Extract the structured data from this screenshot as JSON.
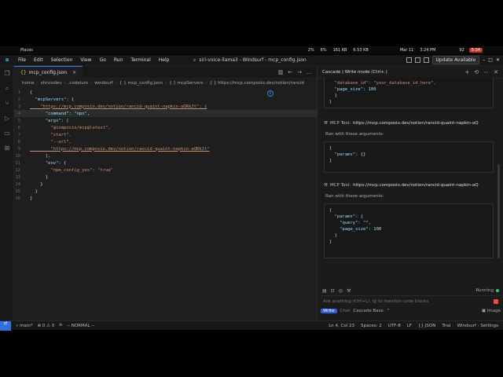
{
  "system_bar": {
    "workspace": "Places",
    "cpu": "2%",
    "mem": "6%",
    "net_up": "161 KB",
    "net_down": "6.53 KB",
    "date": "Mar 11",
    "time": "3:24 PM",
    "volume": "92",
    "battery": "5:34"
  },
  "menubar": {
    "items": [
      "File",
      "Edit",
      "Selection",
      "View",
      "Go",
      "Run",
      "Terminal",
      "Help"
    ],
    "title": "siri-voice-llama3 - Windsurf - mcp_config.json",
    "update_label": "Update Available"
  },
  "editor": {
    "tab_label": "mcp_config.json",
    "breadcrumb": [
      "home",
      "shricodev",
      ".codeium",
      "windsurf",
      "{ } mcp_config.json",
      "{ } mcpServers",
      "{ } https://mcp.composio.dev/notion/rancid"
    ],
    "lines": [
      {
        "n": "1",
        "text": "{"
      },
      {
        "n": "2",
        "text": "  \"mcpServers\": {"
      },
      {
        "n": "3",
        "text": "    \"https://mcp.composio.dev/notion/rancid-quaint-napkin-aQRkJt\": {"
      },
      {
        "n": "4",
        "text": "      \"command\": \"npx\","
      },
      {
        "n": "5",
        "text": "      \"args\": ["
      },
      {
        "n": "6",
        "text": "        \"@composio/mcp@latest\","
      },
      {
        "n": "7",
        "text": "        \"start\","
      },
      {
        "n": "8",
        "text": "        \"--url\","
      },
      {
        "n": "9",
        "text": "        \"https://mcp.composio.dev/notion/rancid-quaint-napkin-aQRkJt\""
      },
      {
        "n": "10",
        "text": "      ],"
      },
      {
        "n": "11",
        "text": "      \"env\": {"
      },
      {
        "n": "12",
        "text": "        \"npm_config_yes\": \"true\""
      },
      {
        "n": "13",
        "text": "      }"
      },
      {
        "n": "14",
        "text": "    }"
      },
      {
        "n": "15",
        "text": "  }"
      },
      {
        "n": "16",
        "text": "}"
      }
    ]
  },
  "cascade": {
    "title": "Cascade | Write mode (Ctrl+.)",
    "card1_lines": [
      "  \"database_id\": \"your_database_id_here\",",
      "  \"page_size\": 100",
      "  }",
      "}"
    ],
    "tool1_label": "MCP Tool:",
    "tool1_url": "https://mcp.composio.dev/notion/rancid-quaint-napkin-aQ",
    "ran1": "Ran with these arguments:",
    "card2_lines": [
      "{",
      "  \"params\": {}",
      "}"
    ],
    "tool2_label": "MCP Tool:",
    "tool2_url": "https://mcp.composio.dev/notion/rancid-quaint-napkin-aQ",
    "ran2": "Ran with these arguments:",
    "card3_lines": [
      "{",
      "  \"params\": {",
      "    \"query\": \"\",",
      "    \"page_size\": 100",
      "  }",
      "}"
    ],
    "running": "Running",
    "ask_placeholder": "Ask anything (Ctrl+L), @ to mention code blocks",
    "mode_write": "Write",
    "mode_chat": "Chat",
    "model": "Cascade Base",
    "image_label": "Image"
  },
  "statusbar": {
    "branch": "main*",
    "errors": "0",
    "warnings": "0",
    "mode": "-- NORMAL --",
    "position": "Ln 4, Col 23",
    "spaces": "Spaces: 2",
    "encoding": "UTF-8",
    "eol": "LF",
    "language": "{} JSON",
    "trial": "Trial",
    "settings": "Windsurf - Settings"
  }
}
